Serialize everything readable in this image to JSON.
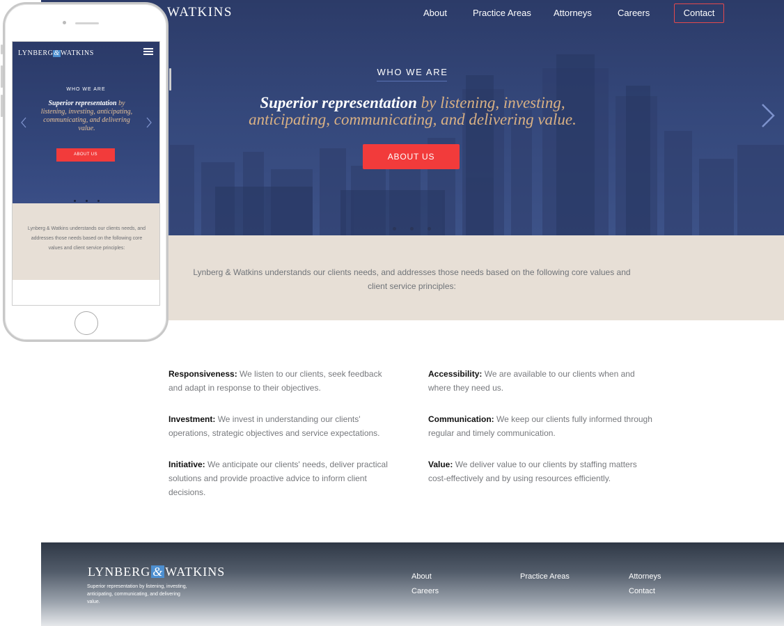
{
  "brand": {
    "name_part1": "Lynberg",
    "ampersand": "&",
    "name_part2": "Watkins",
    "hero_logo_visible": "WATKINS",
    "accent_color": "#f23b3b",
    "navy_color": "#2c3b68",
    "gold_text_color": "#d9b184",
    "beige_color": "#e7dfd6"
  },
  "nav": {
    "about": "About",
    "practice_areas": "Practice Areas",
    "attorneys": "Attorneys",
    "careers": "Careers",
    "contact": "Contact"
  },
  "hero": {
    "eyebrow": "WHO WE ARE",
    "headline_strong": "Superior representation",
    "headline_rest": " by listening, investing, anticipating, communicating, and delivering value.",
    "cta_label": "ABOUT US",
    "next_icon": "chevron-right-icon"
  },
  "intro": {
    "text": "Lynberg & Watkins understands our clients needs, and addresses those needs based on the following core values and client service principles:"
  },
  "values": [
    {
      "title": "Responsiveness:",
      "text": " We listen to our clients, seek feedback and adapt in response to their objectives."
    },
    {
      "title": "Accessibility:",
      "text": " We are available to our clients when and where they need us."
    },
    {
      "title": "Investment:",
      "text": " We invest in understanding our clients' operations, strategic objectives and service expectations."
    },
    {
      "title": "Communication:",
      "text": " We keep our clients fully informed through regular and timely communication."
    },
    {
      "title": "Initiative:",
      "text": " We anticipate our clients' needs, deliver practical solutions and provide proactive advice to inform client decisions."
    },
    {
      "title": "Value:",
      "text": " We deliver value to our clients by staffing matters cost-effectively and by using resources efficiently."
    }
  ],
  "footer": {
    "logo_part1": "LYNBERG",
    "logo_amp": "&",
    "logo_part2": "WATKINS",
    "tagline": "Superior representation by listening, investing, anticipating, communicating, and delivering value.",
    "links": {
      "about": "About",
      "careers": "Careers",
      "practice_areas": "Practice Areas",
      "attorneys": "Attorneys",
      "contact": "Contact"
    }
  },
  "mobile": {
    "logo_part1": "LYNBERG",
    "logo_amp": "&",
    "logo_part2": "WATKINS",
    "menu_icon": "hamburger-menu-icon",
    "eyebrow": "WHO WE ARE",
    "headline_strong": "Superior representation",
    "headline_rest": " by listening, investing, anticipating, communicating, and delivering value.",
    "cta_label": "ABOUT US",
    "intro_text": "Lynberg & Watkins understands our clients needs, and addresses those needs based on the following core values and client service principles:"
  }
}
